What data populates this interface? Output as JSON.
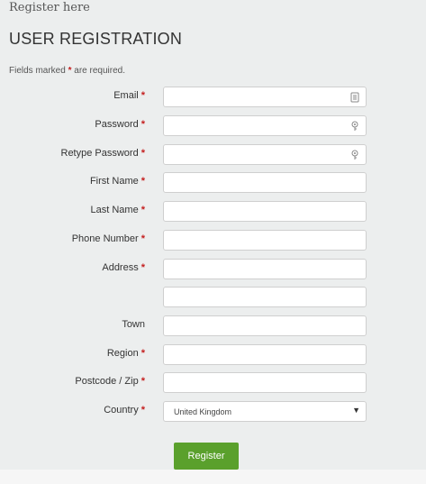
{
  "page": {
    "top_title": "Register here",
    "heading": "USER REGISTRATION",
    "required_note_prefix": "Fields marked",
    "required_star": "*",
    "required_note_suffix": "are required."
  },
  "fields": {
    "email": {
      "label": "Email",
      "value": "",
      "icon": "contact-card-icon"
    },
    "password": {
      "label": "Password",
      "value": "",
      "icon": "key-icon"
    },
    "retype_password": {
      "label": "Retype Password",
      "value": "",
      "icon": "key-icon"
    },
    "first_name": {
      "label": "First Name",
      "value": ""
    },
    "last_name": {
      "label": "Last Name",
      "value": ""
    },
    "phone": {
      "label": "Phone Number",
      "value": ""
    },
    "address": {
      "label": "Address",
      "value": ""
    },
    "address2": {
      "label": "",
      "value": ""
    },
    "town": {
      "label": "Town",
      "value": ""
    },
    "region": {
      "label": "Region",
      "value": ""
    },
    "postcode": {
      "label": "Postcode / Zip",
      "value": ""
    },
    "country": {
      "label": "Country",
      "selected": "United Kingdom"
    }
  },
  "actions": {
    "register_label": "Register"
  },
  "colors": {
    "background": "#eceeee",
    "required_star": "#c41e1e",
    "register_button": "#5aa02c"
  }
}
